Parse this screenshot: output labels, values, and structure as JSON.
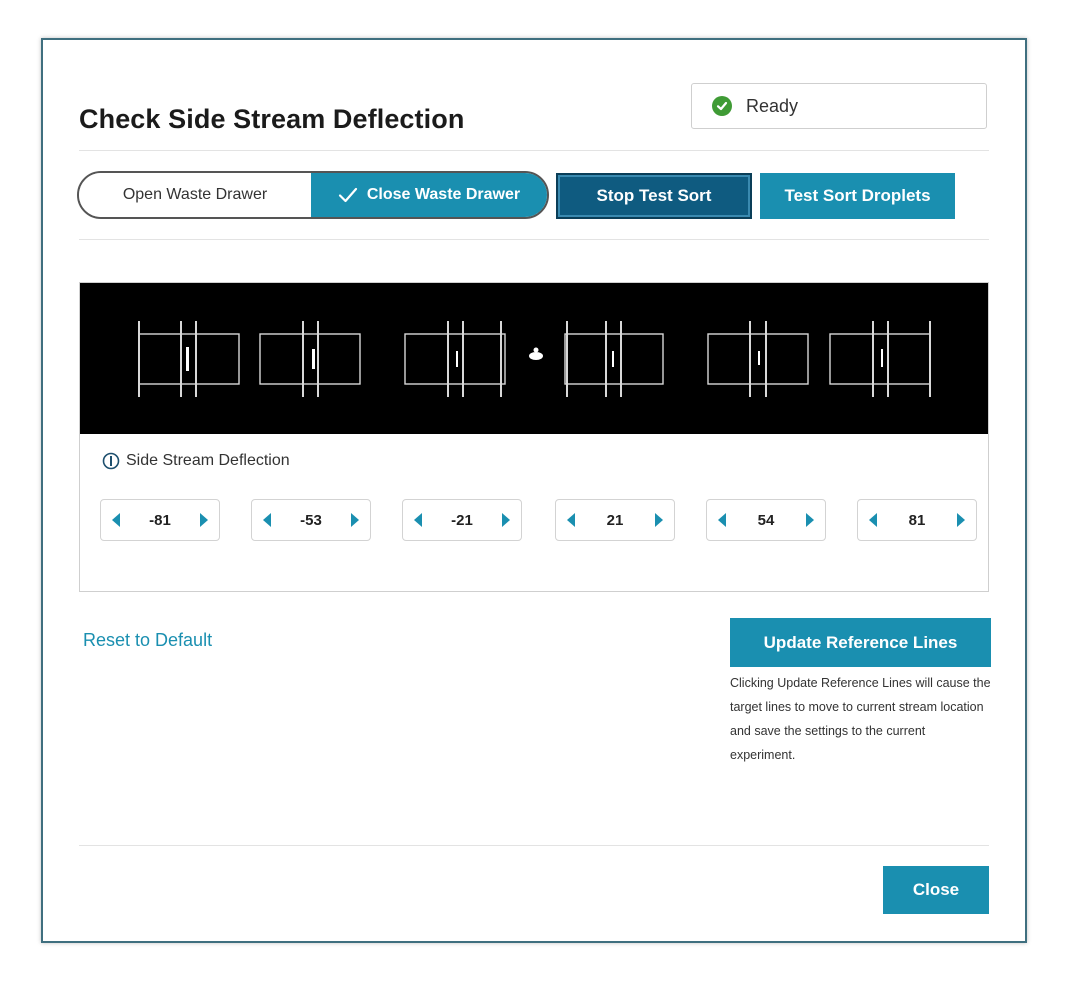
{
  "dialog": {
    "title": "Check Side Stream Deflection"
  },
  "status": {
    "text": "Ready",
    "icon": "check-circle-icon",
    "color": "#3f9b35"
  },
  "waste_drawer": {
    "open_label": "Open Waste Drawer",
    "close_label": "Close Waste Drawer",
    "selected": "close"
  },
  "buttons": {
    "stop_test_sort": "Stop Test Sort",
    "test_sort_droplets": "Test Sort Droplets",
    "update_reference_lines": "Update Reference Lines",
    "close": "Close"
  },
  "deflection": {
    "label": "Side Stream Deflection",
    "values": [
      "-81",
      "-53",
      "-21",
      "21",
      "54",
      "81"
    ]
  },
  "reset_link": "Reset to Default",
  "update_note": "Clicking Update Reference Lines will cause the target lines to move to current stream location and save the settings to the current experiment.",
  "colors": {
    "accent": "#1a8fb0",
    "accent_dark": "#0f5b80"
  }
}
